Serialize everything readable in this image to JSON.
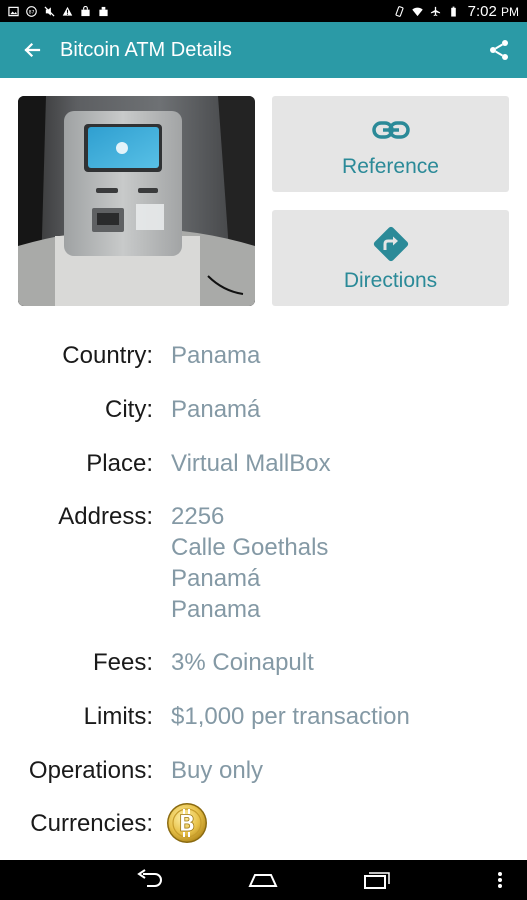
{
  "status_bar": {
    "time": "7:02",
    "time_suffix": "PM",
    "left_icons": [
      "image-icon",
      "sms-icon",
      "mute-icon",
      "warning-icon",
      "shop-icon",
      "download-icon"
    ],
    "right_icons": [
      "vibrate-icon",
      "wifi-icon",
      "airplane-icon",
      "battery-icon"
    ]
  },
  "app_bar": {
    "title": "Bitcoin ATM Details",
    "color": "#2b9aa6"
  },
  "actions": {
    "reference_label": "Reference",
    "directions_label": "Directions",
    "accent_color": "#2b8a98"
  },
  "details": {
    "country_label": "Country:",
    "country": "Panama",
    "city_label": "City:",
    "city": "Panamá",
    "place_label": "Place:",
    "place": "Virtual MallBox",
    "address_label": "Address:",
    "address_lines": [
      "2256",
      "Calle Goethals",
      "Panamá",
      "Panama"
    ],
    "fees_label": "Fees:",
    "fees": "3% Coinapult",
    "limits_label": "Limits:",
    "limits": "$1,000 per transaction",
    "operations_label": "Operations:",
    "operations": "Buy only",
    "currencies_label": "Currencies:",
    "currencies": [
      "bitcoin-icon"
    ]
  },
  "nav_bar": {
    "buttons": [
      "back-icon",
      "home-icon",
      "recents-icon"
    ]
  }
}
